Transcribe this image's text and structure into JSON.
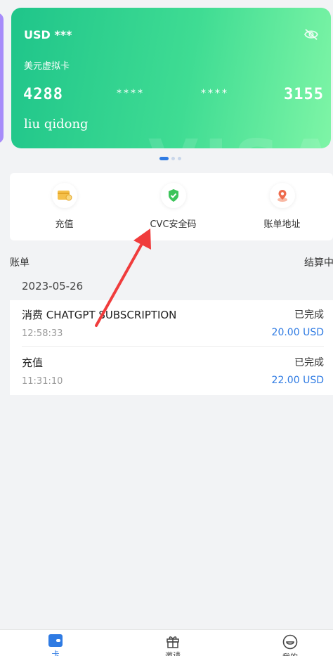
{
  "card": {
    "currency": "USD ***",
    "type": "美元虚拟卡",
    "first4": "4288",
    "mask1": "****",
    "mask2": "****",
    "last4": "3155",
    "holder": "liu qidong",
    "brand_watermark": "VISA",
    "color_start": "#1fc58a",
    "color_end": "#7ef5a6"
  },
  "carousel": {
    "pages": 3,
    "active": 1
  },
  "actions": [
    {
      "label": "充值",
      "icon": "wallet-recharge-icon"
    },
    {
      "label": "CVC安全码",
      "icon": "shield-check-icon"
    },
    {
      "label": "账单地址",
      "icon": "location-pin-icon"
    }
  ],
  "bill": {
    "title": "账单",
    "settle_label": "结算中",
    "date": "2023-05-26"
  },
  "transactions": [
    {
      "title": "消费 CHATGPT SUBSCRIPTION",
      "time": "12:58:33",
      "status": "已完成",
      "amount": "20.00 USD"
    },
    {
      "title": "充值",
      "time": "11:31:10",
      "status": "已完成",
      "amount": "22.00 USD"
    }
  ],
  "tabs": [
    {
      "label": "卡",
      "icon": "card-icon",
      "active": true
    },
    {
      "label": "邀请",
      "icon": "gift-icon",
      "active": false
    },
    {
      "label": "我的",
      "icon": "smile-icon",
      "active": false
    }
  ],
  "annotation": {
    "arrow_color": "#f03c3c"
  },
  "colors": {
    "accent": "#2f7be3",
    "background": "#f2f3f5"
  }
}
